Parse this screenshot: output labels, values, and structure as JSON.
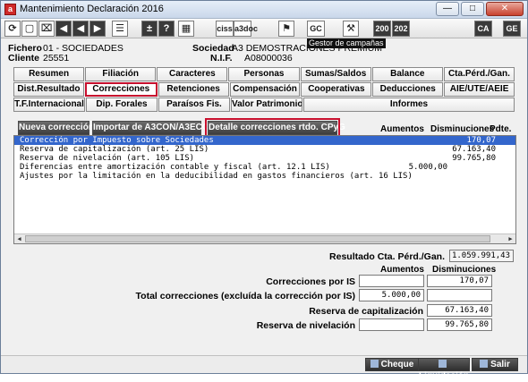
{
  "window": {
    "title": "Mantenimiento Declaración 2016"
  },
  "toolbar": {
    "tooltip": "Gestor de campañas",
    "buttons": [
      "ciss",
      "a3doc",
      "GC",
      "200",
      "202",
      "CA",
      "GE"
    ]
  },
  "info": {
    "fichero_label": "Fichero",
    "fichero_value": "01 - SOCIEDADES",
    "cliente_label": "Cliente",
    "cliente_value": "25551",
    "sociedad_label": "Sociedad",
    "sociedad_value": "A3 DEMOSTRACIONES PREMIUM",
    "nif_label": "N.I.F.",
    "nif_value": "A08000036"
  },
  "tabs": {
    "row1": [
      "Resumen",
      "Filiación",
      "Caracteres",
      "Personas",
      "Sumas/Saldos",
      "Balance",
      "Cta.Pérd./Gan."
    ],
    "row2": [
      "Dist.Resultado",
      "Correcciones",
      "Retenciones",
      "Compensación",
      "Cooperativas",
      "Deducciones",
      "AIE/UTE/AEIE"
    ],
    "row3": [
      "T.F.Internacional",
      "Dip. Forales",
      "Paraísos Fis.",
      "Valor Patrimonio",
      "Informes"
    ],
    "active": "Correcciones"
  },
  "actions": {
    "nueva": "Nueva corrección",
    "importar": "Importar de A3CON/A3ECO",
    "detalle": "Detalle correcciones rtdo. CPyG"
  },
  "columns": {
    "aumentos": "Aumentos",
    "disminuciones": "Disminuciones",
    "pdte": "Pdte."
  },
  "corrections": [
    {
      "desc": "Corrección por Impuesto sobre Sociedades",
      "aumentos": "",
      "disminuciones": "170,07"
    },
    {
      "desc": "Reserva de capitalización (art. 25 LIS)",
      "aumentos": "",
      "disminuciones": "67.163,40"
    },
    {
      "desc": "Reserva de nivelación (art. 105 LIS)",
      "aumentos": "",
      "disminuciones": "99.765,80"
    },
    {
      "desc": "Diferencias entre amortización contable y fiscal (art. 12.1 LIS)",
      "aumentos": "5.000,00",
      "disminuciones": ""
    },
    {
      "desc": "Ajustes por la limitación en la deducibilidad en gastos financieros (art. 16 LIS)",
      "aumentos": "",
      "disminuciones": ""
    }
  ],
  "summary": {
    "resultado_label": "Resultado Cta. Pérd./Gan.",
    "resultado_value": "1.059.991,43",
    "aumentos_hdr": "Aumentos",
    "disminuciones_hdr": "Disminuciones",
    "corr_is_label": "Correcciones por IS",
    "corr_is_aumentos": "",
    "corr_is_disminuciones": "170,07",
    "total_label": "Total correcciones (excluída la corrección por IS)",
    "total_aumentos": "5.000,00",
    "total_disminuciones": "",
    "reserva_cap_label": "Reserva de capitalización",
    "reserva_cap_value": "67.163,40",
    "reserva_niv_label": "Reserva de nivelación",
    "reserva_niv_aumentos": "",
    "reserva_niv_value": "99.765,80"
  },
  "bottom": {
    "cheque": "Cheque",
    "liquidacion": "Liquidación",
    "salir": "Salir"
  }
}
